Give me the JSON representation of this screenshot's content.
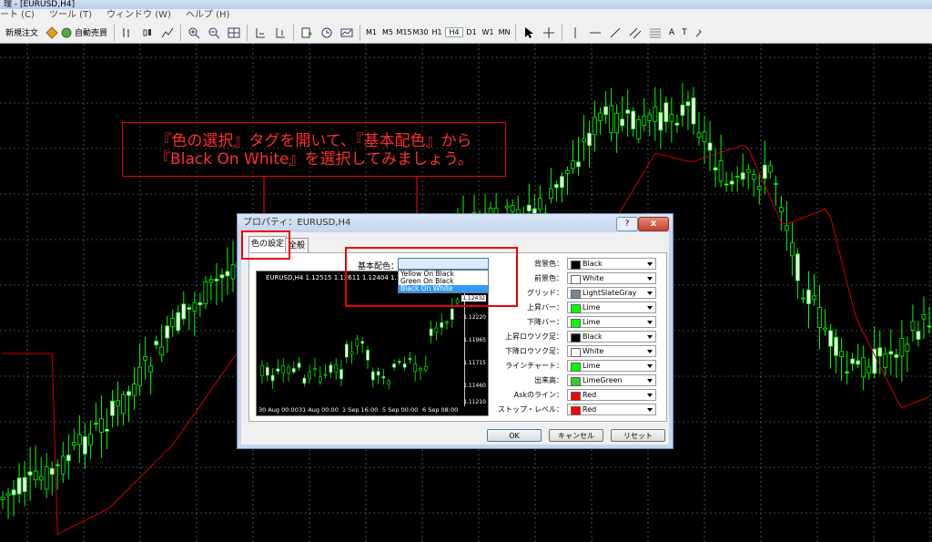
{
  "window": {
    "title": "理 - [EURUSD,H4]"
  },
  "menu": {
    "items": [
      "ート (C)",
      "ツール (T)",
      "ウィンドウ (W)",
      "ヘルプ (H)"
    ]
  },
  "toolbar": {
    "new_order_label": "新規注文",
    "auto_trade_label": "自動売買",
    "periods": [
      "M1",
      "M5",
      "M15",
      "M30",
      "H1",
      "H4",
      "D1",
      "W1",
      "MN"
    ],
    "active_period": "H4",
    "text_tool_label": "A",
    "label_tool_label": "T"
  },
  "callout": {
    "line1": "『色の選択』タグを開いて、『基本配色』から",
    "line2": "『Black On White』を選択してみましょう。"
  },
  "dialog": {
    "title": "プロパティ：EURUSD,H4",
    "help_label": "?",
    "close_label": "x",
    "tabs": [
      {
        "label": "色の設定",
        "active": true
      },
      {
        "label": "全般",
        "active": false
      }
    ],
    "scheme": {
      "label": "基本配色：",
      "value": "",
      "options": [
        "Yellow On Black",
        "Green On Black",
        "Black On White"
      ],
      "highlighted": "Black On White"
    },
    "preview": {
      "title": "EURUSD,H4  1.12515  1.12611  1.12404  1.12432",
      "prices": [
        "1.12432",
        "1.12220",
        "1.11965",
        "1.11715",
        "1.11460",
        "1.11210"
      ],
      "highlight_price": "1.12432",
      "dates": [
        "30 Aug 00:00",
        "31 Aug 00:00",
        "1 Sep 16:00",
        "5 Sep 00:00",
        "6 Sep 08:00"
      ]
    },
    "colors": [
      {
        "label": "背景色：",
        "value": "Black",
        "swatch": "#000000"
      },
      {
        "label": "前景色：",
        "value": "White",
        "swatch": "#ffffff"
      },
      {
        "label": "グリッド：",
        "value": "LightSlateGray",
        "swatch": "#778899"
      },
      {
        "label": "上昇バー：",
        "value": "Lime",
        "swatch": "#00ff00"
      },
      {
        "label": "下降バー：",
        "value": "Lime",
        "swatch": "#00ff00"
      },
      {
        "label": "上昇ロウソク足：",
        "value": "Black",
        "swatch": "#000000"
      },
      {
        "label": "下降ロウソク足：",
        "value": "White",
        "swatch": "#ffffff"
      },
      {
        "label": "ラインチャート：",
        "value": "Lime",
        "swatch": "#00ff00"
      },
      {
        "label": "出来高：",
        "value": "LimeGreen",
        "swatch": "#32cd32"
      },
      {
        "label": "Askのライン：",
        "value": "Red",
        "swatch": "#ff0000"
      },
      {
        "label": "ストップ・レベル：",
        "value": "Red",
        "swatch": "#ff0000"
      }
    ],
    "buttons": {
      "ok": "OK",
      "cancel": "キャンセル",
      "reset": "リセット"
    }
  },
  "chart_colors": {
    "background": "#000000",
    "candles": "#00ff00",
    "bull_body": "#000000",
    "bear_body": "#ffffff",
    "moving_average": "#cc0000",
    "grid": "#778899",
    "annotation": "#ff0000"
  }
}
